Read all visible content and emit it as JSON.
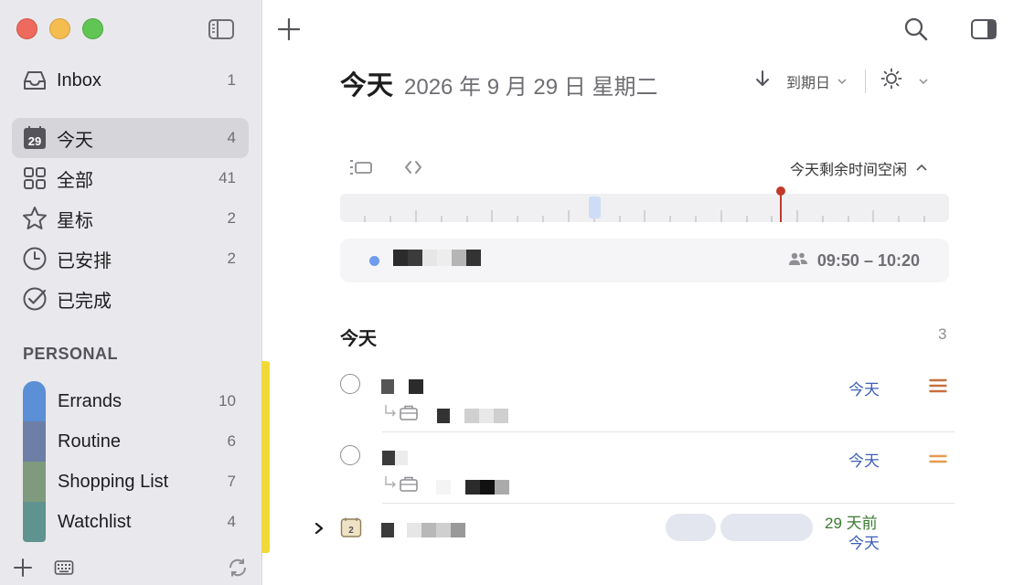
{
  "sidebar": {
    "nav": [
      {
        "label": "Inbox",
        "count": "1",
        "icon": "inbox-icon"
      },
      {
        "label": "今天",
        "count": "4",
        "icon": "calendar-today-icon",
        "day": "29"
      },
      {
        "label": "全部",
        "count": "41",
        "icon": "grid-icon"
      },
      {
        "label": "星标",
        "count": "2",
        "icon": "star-icon"
      },
      {
        "label": "已安排",
        "count": "2",
        "icon": "clock-icon"
      },
      {
        "label": "已完成",
        "count": "",
        "icon": "checkmark-circle-icon"
      }
    ],
    "section_title": "PERSONAL",
    "lists": [
      {
        "label": "Errands",
        "count": "10",
        "color": "#5b8fd6"
      },
      {
        "label": "Routine",
        "count": "6",
        "color": "#6d7fa6"
      },
      {
        "label": "Shopping List",
        "count": "7",
        "color": "#7f9a7c"
      },
      {
        "label": "Watchlist",
        "count": "4",
        "color": "#5f938f"
      }
    ]
  },
  "header": {
    "title": "今天",
    "date": "2026 年 9 月 29 日  星期二",
    "sort_label": "到期日"
  },
  "timeline": {
    "free_time_label": "今天剩余时间空闲",
    "event": {
      "time": "09:50 – 10:20"
    }
  },
  "today_section": {
    "title": "今天",
    "count": "3",
    "tasks": [
      {
        "due": "今天",
        "priority_color": "#c8703e"
      },
      {
        "due": "今天",
        "priority_color": "#e59a4e"
      },
      {
        "due_ago": "29 天前",
        "due": "今天",
        "subtask_count": "2"
      }
    ]
  },
  "colors": {
    "accent": "#3c5fb5",
    "due_ago": "#3a7a2e",
    "now_marker": "#c0392b",
    "highlight": "#f1d93a"
  }
}
